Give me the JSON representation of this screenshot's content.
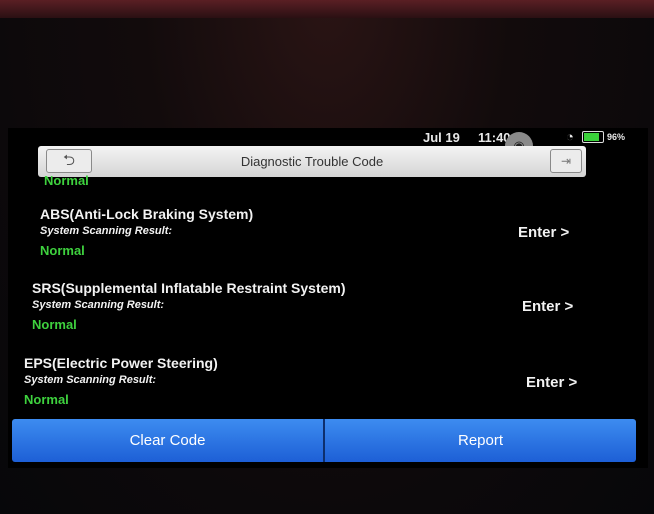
{
  "status": {
    "date": "Jul 19",
    "time": "11:40",
    "battery_pct": "96%",
    "battery_level": 0.96
  },
  "header": {
    "title": "Diagnostic Trouble Code",
    "back_icon": "back-arrow-icon",
    "exit_icon": "exit-icon"
  },
  "list": {
    "top_result": "Normal",
    "systems": [
      {
        "name": "ABS(Anti-Lock Braking System)",
        "label": "System Scanning Result:",
        "result": "Normal",
        "action": "Enter >"
      },
      {
        "name": "SRS(Supplemental Inflatable Restraint System)",
        "label": "System Scanning Result:",
        "result": "Normal",
        "action": "Enter >"
      },
      {
        "name": "EPS(Electric Power Steering)",
        "label": "System Scanning Result:",
        "result": "Normal",
        "action": "Enter >"
      }
    ]
  },
  "footer": {
    "clear_label": "Clear Code",
    "report_label": "Report"
  },
  "colors": {
    "normal_green": "#3ed13e",
    "button_blue": "#2f78e8"
  }
}
